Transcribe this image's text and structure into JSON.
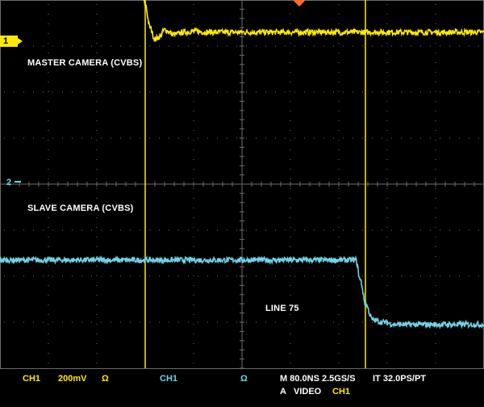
{
  "labels": {
    "master": "MASTER CAMERA (CVBS)",
    "slave": "SLAVE CAMERA (CVBS)",
    "line": "LINE 75"
  },
  "markers": {
    "ch1": "1",
    "ch2": "2"
  },
  "readout": {
    "ch1_name": "CH1",
    "ch1_scale": "200mV",
    "ch1_ohm": "Ω",
    "ch2_name": "CH1",
    "ch2_ohm": "Ω",
    "timebase": "M 80.0NS 2.5GS/S",
    "interp": "IT 32.0PS/PT",
    "trigger_mode": "A",
    "trigger_source_type": "VIDEO",
    "trigger_channel": "CH1"
  },
  "colors": {
    "background": "#000000",
    "grid": "#6b6b6b",
    "ch1": "#ffea00",
    "ch2": "#6fd3e6",
    "trigger": "#ff6a2a",
    "text": "#ffffff"
  },
  "chart_data": {
    "type": "line",
    "title": "",
    "grid": true,
    "divisions": {
      "x": 10,
      "y": 8
    },
    "series": [
      {
        "name": "MASTER CAMERA (CVBS)",
        "x": [
          0,
          2.7,
          2.9,
          3.0,
          3.1,
          3.2,
          3.3,
          3.4,
          3.6,
          3.8,
          4.0,
          4.3,
          10
        ],
        "y": [
          4.7,
          4.7,
          4.4,
          3.9,
          3.4,
          3.15,
          3.2,
          3.35,
          3.25,
          3.3,
          3.32,
          3.3,
          3.3
        ]
      },
      {
        "name": "SLAVE CAMERA (CVBS)",
        "x": [
          0,
          7.35,
          7.45,
          7.55,
          7.7,
          7.9,
          8.2,
          10
        ],
        "y": [
          -1.65,
          -1.65,
          -2.1,
          -2.6,
          -2.95,
          -3.0,
          -3.05,
          -3.05
        ]
      }
    ],
    "cursors_x": [
      3.0,
      7.55
    ]
  }
}
